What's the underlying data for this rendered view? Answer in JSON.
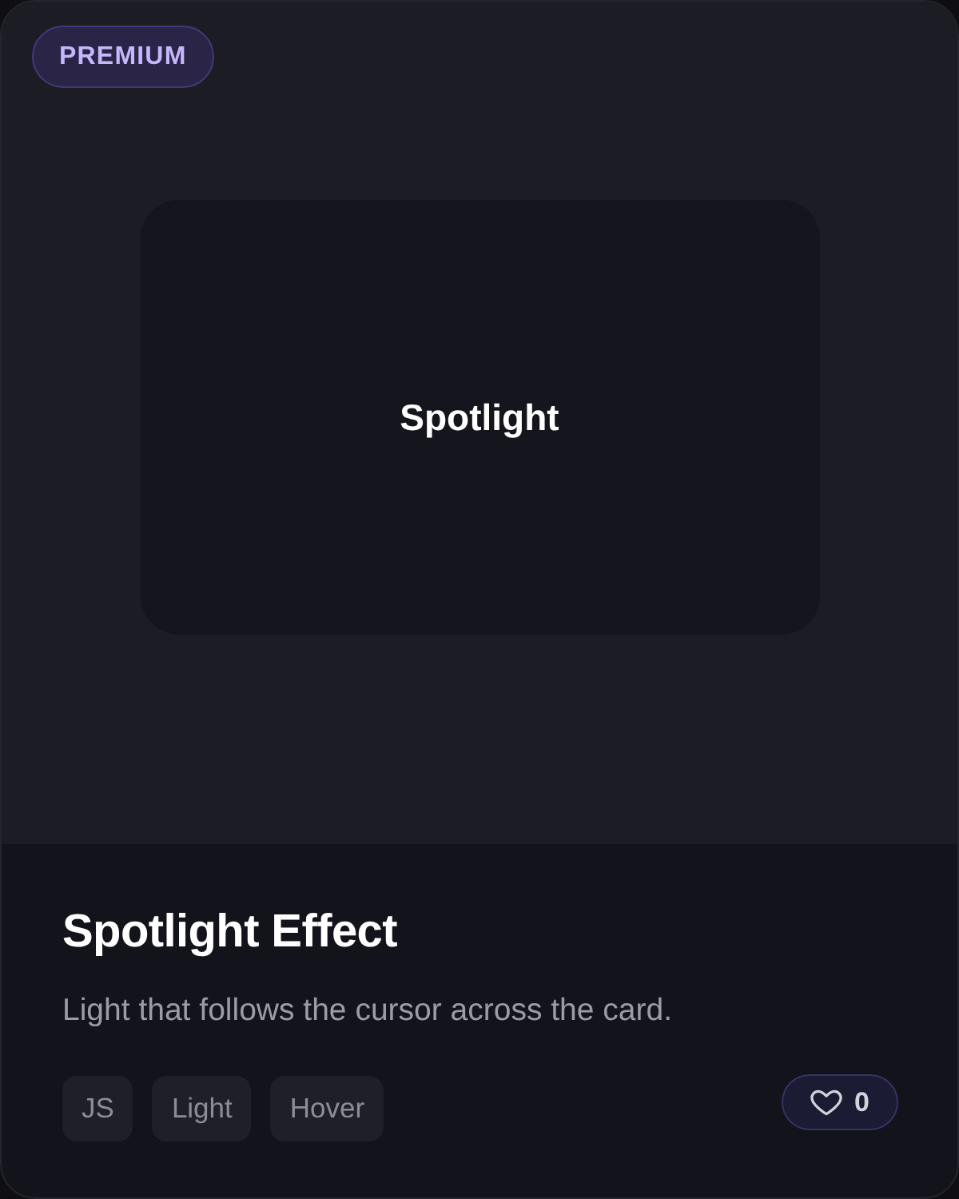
{
  "badge": {
    "label": "PREMIUM"
  },
  "preview": {
    "label": "Spotlight"
  },
  "title": "Spotlight Effect",
  "description": "Light that follows the cursor across the card.",
  "tags": [
    "JS",
    "Light",
    "Hover"
  ],
  "like": {
    "count": "0",
    "liked": false
  }
}
